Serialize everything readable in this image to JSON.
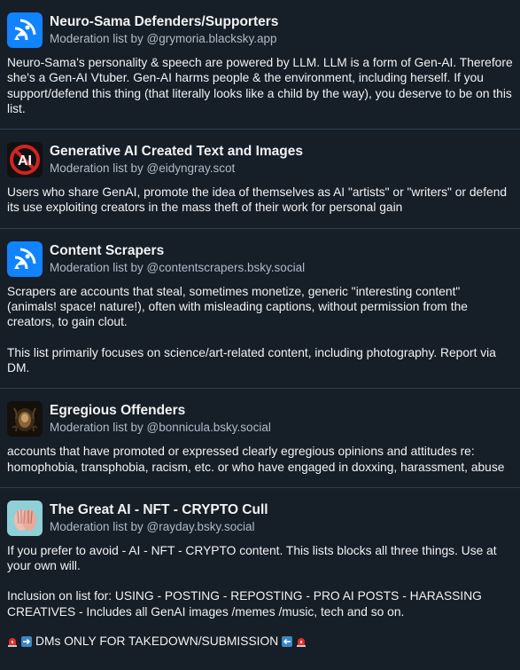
{
  "lists": [
    {
      "title": "Neuro-Sama Defenders/Supporters",
      "byline": "Moderation list by @grymoria.blacksky.app",
      "avatar_icon": "satellite-dish-icon",
      "description": "Neuro-Sama's personality & speech are powered by LLM. LLM is a form of Gen-AI. Therefore she's a Gen-AI Vtuber. Gen-AI harms people & the environment, including herself. If you support/defend this thing (that literally looks like a child by the way), you deserve to be on this list."
    },
    {
      "title": "Generative AI Created Text and Images",
      "byline": "Moderation list by @eidyngray.scot",
      "avatar_icon": "no-ai-icon",
      "avatar_text": "AI",
      "description": "Users who share GenAI, promote the idea of themselves as AI \"artists\" or \"writers\" or defend its use exploiting creators in the mass theft of their work for personal gain"
    },
    {
      "title": "Content Scrapers",
      "byline": "Moderation list by @contentscrapers.bsky.social",
      "avatar_icon": "satellite-dish-icon",
      "description_1": "Scrapers are accounts that steal, sometimes monetize, generic \"interesting content\" (animals! space! nature!), often with misleading captions, without permission from the creators, to gain clout.",
      "description_2": "This list primarily focuses on science/art-related content, including photography. Report via DM."
    },
    {
      "title": "Egregious Offenders",
      "byline": "Moderation list by @bonnicula.bsky.social",
      "avatar_icon": "painting-avatar-icon",
      "description": "accounts that have promoted or expressed clearly egregious opinions and attitudes re: homophobia, transphobia, racism, etc. or who have engaged in doxxing, harassment, abuse"
    },
    {
      "title": "The Great AI - NFT - CRYPTO Cull",
      "byline": "Moderation list by @rayday.bsky.social",
      "avatar_icon": "hands-avatar-icon",
      "description_1": "If you prefer to avoid - AI - NFT - CRYPTO content. This lists blocks all three things. Use at your own will.",
      "description_2": "Inclusion on list for: USING - POSTING - REPOSTING - PRO AI POSTS -  HARASSING CREATIVES - Includes all GenAI images /memes /music, tech and so on.",
      "description_3": "DMs ONLY FOR TAKEDOWN/SUBMISSION"
    }
  ],
  "colors": {
    "background": "#161e27",
    "divider": "#2e4052",
    "accent_blue": "#1083fe",
    "muted_text": "#aebbc9"
  }
}
